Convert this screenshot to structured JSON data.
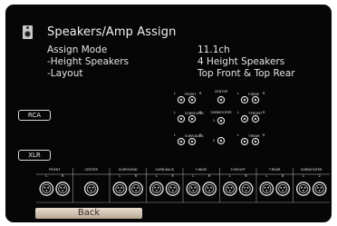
{
  "header": {
    "title": "Speakers/Amp Assign",
    "icon": "speaker-icon"
  },
  "settings": [
    {
      "label": "Assign Mode",
      "value": "11.1ch"
    },
    {
      "label": "-Height Speakers",
      "value": "4 Height Speakers"
    },
    {
      "label": "-Layout",
      "value": "Top Front & Top Rear"
    }
  ],
  "panel": {
    "rca_label": "RCA",
    "xlr_label": "XLR",
    "rca_jacks": {
      "front": "FRONT",
      "center": "CENTER",
      "front_wide": "F.WIDE",
      "surround": "SURROUND",
      "subwoofer": "SUBWOOFER",
      "top_front": "T.FRONT",
      "surr_back": "SURR.BACK",
      "top_rear": "T.REAR",
      "sw1": "1",
      "sw2": "2",
      "left_mark": "L",
      "right_mark": "R"
    },
    "xlr_groups": [
      {
        "name": "FRONT"
      },
      {
        "name": "CENTER"
      },
      {
        "name": "SURROUND"
      },
      {
        "name": "SURR.BACK"
      },
      {
        "name": "F.WIDE"
      },
      {
        "name": "F.HEIGHT"
      },
      {
        "name": "T.REAR"
      },
      {
        "name": "SUBWOOFER"
      }
    ],
    "xlr_sub": {
      "l": "L",
      "r": "R",
      "c": "",
      "s1": "1",
      "s2": "2"
    }
  },
  "back_button": {
    "label": "Back"
  },
  "colors": {
    "background": "#060606",
    "text": "#e4e4e4",
    "button": "#d8ccbb"
  }
}
